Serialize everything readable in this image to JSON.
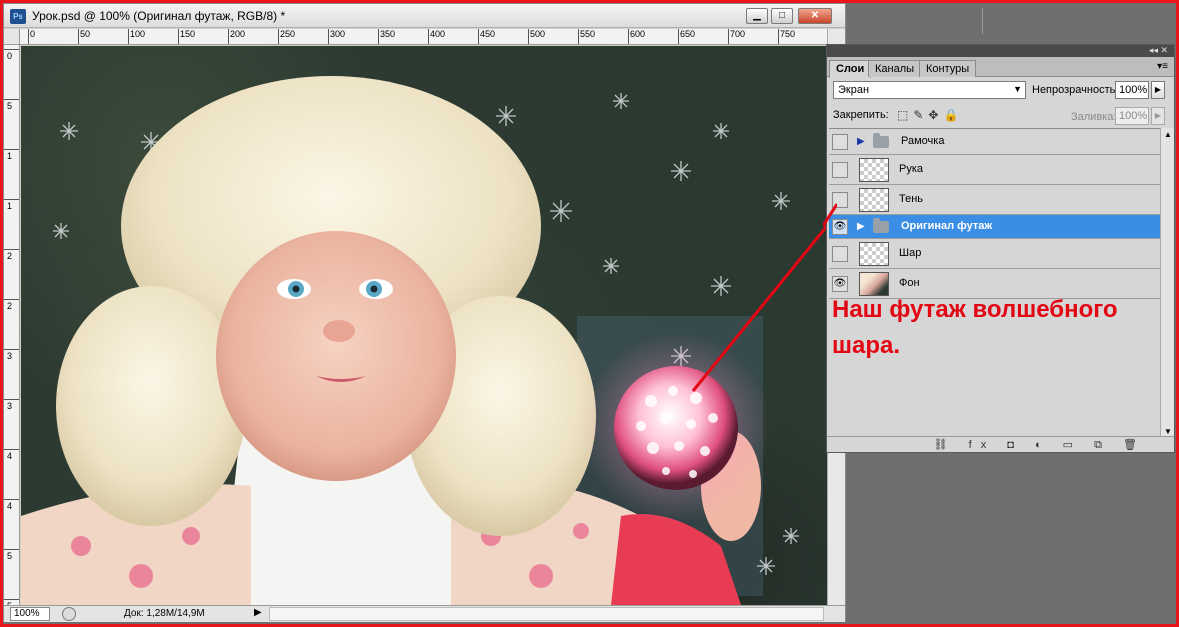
{
  "window": {
    "title": "Урок.psd @ 100% (Оригинал футаж, RGB/8) *",
    "app_icon": "Ps",
    "buttons": {
      "minimize": "▁",
      "maximize": "□",
      "close": "✕"
    }
  },
  "ruler_top": [
    "0",
    "50",
    "100",
    "150",
    "200",
    "250",
    "300",
    "350",
    "400",
    "450",
    "500",
    "550",
    "600",
    "650",
    "700",
    "750"
  ],
  "ruler_left": [
    "0",
    "5",
    "1",
    "1",
    "2",
    "2",
    "3",
    "3",
    "4",
    "4",
    "5",
    "5"
  ],
  "status": {
    "zoom": "100%",
    "doc_info": "Док: 1,28M/14,9M",
    "arrow": "▶"
  },
  "panel": {
    "collapse_glyphs": "◂◂ ✕",
    "tabs": [
      "Слои",
      "Каналы",
      "Контуры"
    ],
    "menu_glyph": "▾≡",
    "blend_mode": "Экран",
    "opacity_label": "Непрозрачность:",
    "opacity_value": "100%",
    "lock_label": "Закрепить:",
    "lock_icons": "⬚✎✥🔒",
    "fill_label": "Заливка:",
    "fill_value": "100%",
    "layers": [
      {
        "name": "Рамочка",
        "type": "group",
        "visible": false,
        "selected": false
      },
      {
        "name": "Рука",
        "type": "layer",
        "visible": false,
        "selected": false
      },
      {
        "name": "Тень",
        "type": "layer",
        "visible": false,
        "selected": false
      },
      {
        "name": "Оригинал футаж",
        "type": "group",
        "visible": true,
        "selected": true
      },
      {
        "name": "Шар",
        "type": "layer",
        "visible": false,
        "selected": false
      },
      {
        "name": "Фон",
        "type": "photo",
        "visible": true,
        "selected": false
      }
    ],
    "footer_icons": "⛓ fx ◘ ◐ ▭ ⧉ 🗑"
  },
  "annotation": {
    "text": "Наш футаж волшебного шара.",
    "color": "#e30613"
  },
  "colors": {
    "accent_selection": "#3a8ee6",
    "frame": "#e8161c"
  }
}
